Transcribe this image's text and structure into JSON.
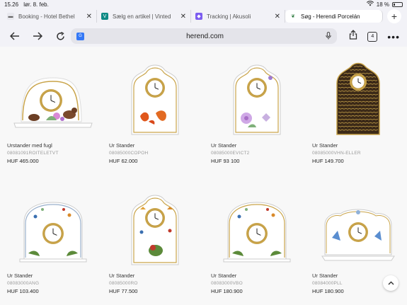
{
  "status": {
    "time": "15.26",
    "date": "lør. 8. feb.",
    "battery": "18 %"
  },
  "tabs": [
    {
      "title": "Booking - Hotel Bethel",
      "icon": "bed-icon",
      "color": "#e8e8ee",
      "active": false
    },
    {
      "title": "Sælg en artikel | Vinted",
      "icon": "v-icon",
      "color": "#0f8a85",
      "active": false
    },
    {
      "title": "Tracking | Akusoli",
      "icon": "tracking-icon",
      "color": "#7c5cf0",
      "active": false
    },
    {
      "title": "Søg - Herendi Porcelán",
      "icon": "leaf-icon",
      "color": "#ffffff",
      "active": true
    }
  ],
  "toolbar": {
    "url": "herend.com",
    "tab_count": "4"
  },
  "products": [
    {
      "name": "Urstander med fugl",
      "sku": "08081091ROITELETVT",
      "currency": "HUF",
      "price": "465.000",
      "style": "bird"
    },
    {
      "name": "Ur Stander",
      "sku": "08085000COPOH",
      "currency": "HUF",
      "price": "62.000",
      "style": "fish"
    },
    {
      "name": "Ur Stander",
      "sku": "08085000EVICT2",
      "currency": "HUF",
      "price": "93 100",
      "style": "flower"
    },
    {
      "name": "Ur Stander",
      "sku": "08085000VHN-ELLER",
      "currency": "HUF",
      "price": "149.700",
      "style": "dark"
    },
    {
      "name": "Ur Stander",
      "sku": "08083000ANG",
      "currency": "HUF",
      "price": "103.400",
      "style": "arch"
    },
    {
      "name": "Ur Stander",
      "sku": "08085000RO",
      "currency": "HUF",
      "price": "77.500",
      "style": "roth"
    },
    {
      "name": "Ur Stander",
      "sku": "08083000VBO",
      "currency": "HUF",
      "price": "180.900",
      "style": "archgold"
    },
    {
      "name": "Ur Stander",
      "sku": "08084000PLL",
      "currency": "HUF",
      "price": "180.900",
      "style": "rococo"
    }
  ]
}
